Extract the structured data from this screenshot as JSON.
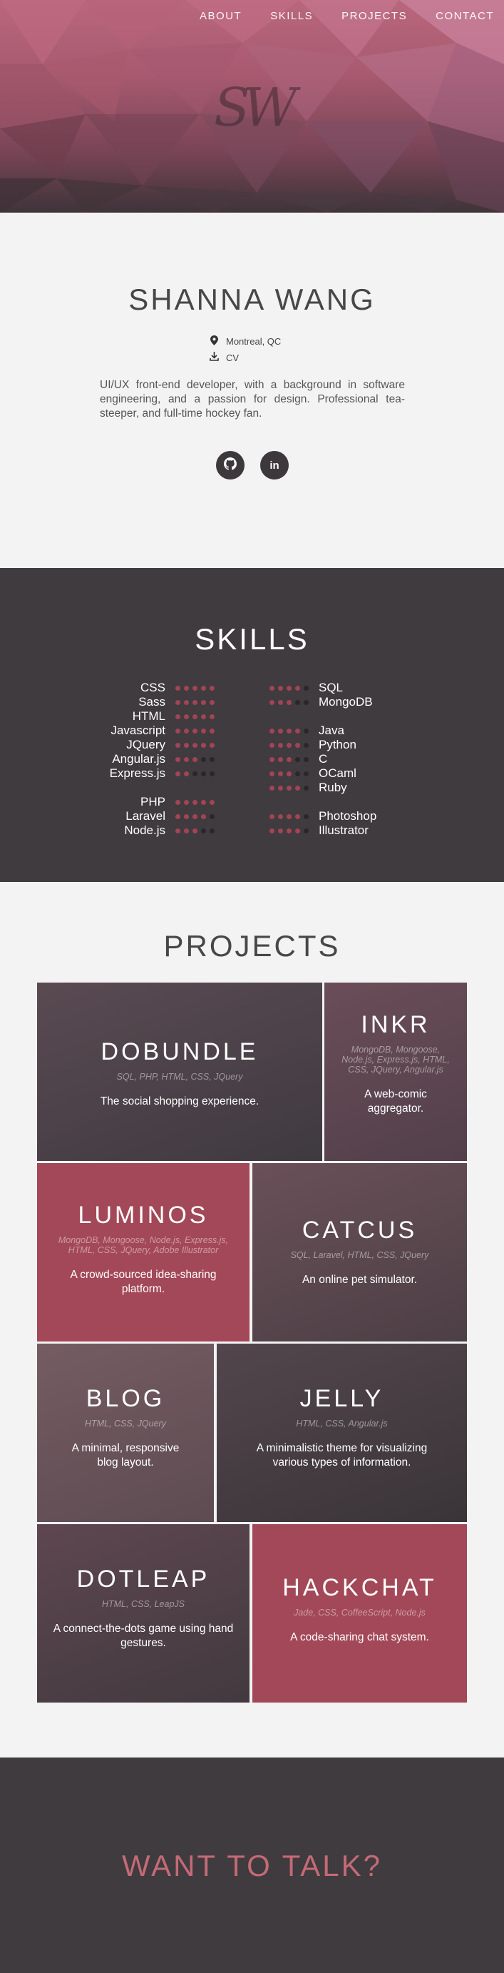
{
  "nav": [
    {
      "label": "ABOUT"
    },
    {
      "label": "SKILLS"
    },
    {
      "label": "PROJECTS"
    },
    {
      "label": "CONTACT"
    }
  ],
  "logo_text": "SW",
  "about": {
    "name": "SHANNA WANG",
    "location": "Montreal, QC",
    "cv_label": "CV",
    "bio": "UI/UX front-end developer, with a background in software engineering, and a passion for design. Professional tea-steeper, and full-time hockey fan.",
    "social": [
      {
        "icon": "github-icon"
      },
      {
        "icon": "linkedin-icon",
        "glyph": "in"
      }
    ]
  },
  "skills": {
    "title": "SKILLS",
    "left": [
      {
        "name": "CSS",
        "level": 5
      },
      {
        "name": "Sass",
        "level": 5
      },
      {
        "name": "HTML",
        "level": 5
      },
      {
        "name": "Javascript",
        "level": 5
      },
      {
        "name": "JQuery",
        "level": 5
      },
      {
        "name": "Angular.js",
        "level": 3
      },
      {
        "name": "Express.js",
        "level": 2
      },
      {
        "name": "PHP",
        "level": 5
      },
      {
        "name": "Laravel",
        "level": 4
      },
      {
        "name": "Node.js",
        "level": 3
      }
    ],
    "right": [
      {
        "name": "SQL",
        "level": 4
      },
      {
        "name": "MongoDB",
        "level": 3
      },
      {
        "name": "Java",
        "level": 4
      },
      {
        "name": "Python",
        "level": 4
      },
      {
        "name": "C",
        "level": 3
      },
      {
        "name": "OCaml",
        "level": 3
      },
      {
        "name": "Ruby",
        "level": 4
      },
      {
        "name": "Photoshop",
        "level": 4
      },
      {
        "name": "Illustrator",
        "level": 4
      }
    ],
    "colors": {
      "on": "#a14455",
      "off": "#2a272a"
    }
  },
  "projects": {
    "title": "PROJECTS",
    "items": [
      {
        "title": "DOBUNDLE",
        "tech": "SQL, PHP, HTML, CSS, JQuery",
        "desc": "The social shopping experience."
      },
      {
        "title": "INKR",
        "tech": "MongoDB, Mongoose, Node.js, Express.js, HTML, CSS, JQuery, Angular.js",
        "desc": "A web-comic aggregator."
      },
      {
        "title": "LUMINOS",
        "tech": "MongoDB, Mongoose, Node.js, Express.js, HTML, CSS, JQuery, Adobe Illustrator",
        "desc": "A crowd-sourced idea-sharing platform."
      },
      {
        "title": "CATCUS",
        "tech": "SQL, Laravel, HTML, CSS, JQuery",
        "desc": "An online pet simulator."
      },
      {
        "title": "BLOG",
        "tech": "HTML, CSS, JQuery",
        "desc": "A minimal, responsive blog layout."
      },
      {
        "title": "JELLY",
        "tech": "HTML, CSS, Angular.js",
        "desc": "A minimalistic theme for visualizing various types of information."
      },
      {
        "title": "DOTLEAP",
        "tech": "HTML, CSS, LeapJS",
        "desc": "A connect-the-dots game using hand gestures."
      },
      {
        "title": "HACKCHAT",
        "tech": "Jade, CSS, CoffeeScript, Node.js",
        "desc": "A code-sharing chat system."
      }
    ]
  },
  "contact": {
    "title": "WANT TO TALK?",
    "accent": "#c46a77"
  }
}
